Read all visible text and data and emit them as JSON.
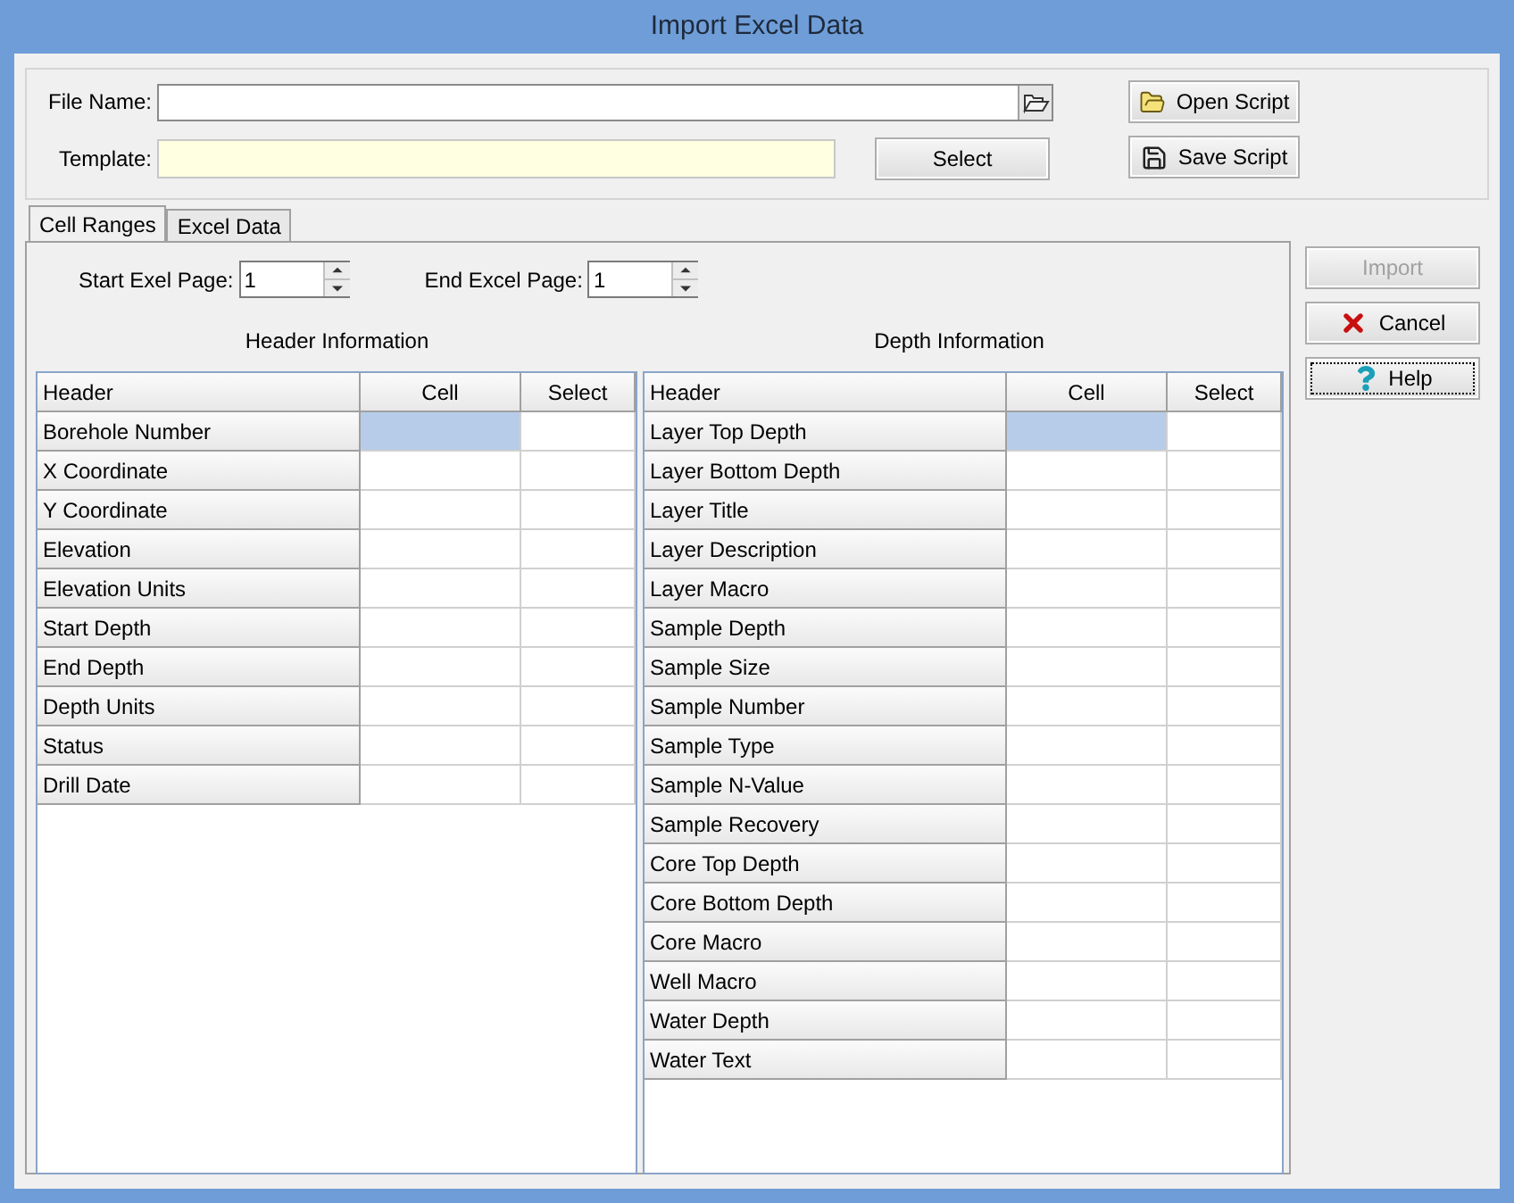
{
  "window": {
    "title": "Import Excel Data"
  },
  "file_name": {
    "label": "File Name:"
  },
  "template": {
    "label": "Template:"
  },
  "select_button": {
    "label": "Select"
  },
  "script_buttons": [
    {
      "kind": "open",
      "label": "Open Script"
    },
    {
      "kind": "save",
      "label": "Save Script"
    }
  ],
  "tabs": [
    {
      "label": "Cell Ranges",
      "selected": true
    },
    {
      "label": "Excel Data",
      "selected": false
    }
  ],
  "start_page": {
    "label": "Start Exel Page:",
    "value": "1"
  },
  "end_page": {
    "label": "End Excel Page:",
    "value": "1"
  },
  "header_table": {
    "title": "Header Information",
    "columns": [
      "Header",
      "Cell",
      "Select"
    ],
    "rows": [
      {
        "header": "Borehole Number",
        "selected": true
      },
      {
        "header": "X Coordinate",
        "selected": false
      },
      {
        "header": "Y Coordinate",
        "selected": false
      },
      {
        "header": "Elevation",
        "selected": false
      },
      {
        "header": "Elevation Units",
        "selected": false
      },
      {
        "header": "Start Depth",
        "selected": false
      },
      {
        "header": "End Depth",
        "selected": false
      },
      {
        "header": "Depth Units",
        "selected": false
      },
      {
        "header": "Status",
        "selected": false
      },
      {
        "header": "Drill Date",
        "selected": false
      }
    ]
  },
  "depth_table": {
    "title": "Depth Information",
    "columns": [
      "Header",
      "Cell",
      "Select"
    ],
    "rows": [
      {
        "header": "Layer Top Depth",
        "selected": true
      },
      {
        "header": "Layer Bottom Depth",
        "selected": false
      },
      {
        "header": "Layer Title",
        "selected": false
      },
      {
        "header": "Layer Description",
        "selected": false
      },
      {
        "header": "Layer Macro",
        "selected": false
      },
      {
        "header": "Sample Depth",
        "selected": false
      },
      {
        "header": "Sample Size",
        "selected": false
      },
      {
        "header": "Sample Number",
        "selected": false
      },
      {
        "header": "Sample Type",
        "selected": false
      },
      {
        "header": "Sample N-Value",
        "selected": false
      },
      {
        "header": "Sample Recovery",
        "selected": false
      },
      {
        "header": "Core Top Depth",
        "selected": false
      },
      {
        "header": "Core Bottom Depth",
        "selected": false
      },
      {
        "header": "Core Macro",
        "selected": false
      },
      {
        "header": "Well Macro",
        "selected": false
      },
      {
        "header": "Water Depth",
        "selected": false
      },
      {
        "header": "Water Text",
        "selected": false
      }
    ]
  },
  "side_buttons": [
    {
      "kind": "import",
      "label": "Import",
      "disabled": true
    },
    {
      "kind": "cancel",
      "label": "Cancel",
      "disabled": false
    },
    {
      "kind": "help",
      "label": "Help",
      "disabled": false
    }
  ]
}
